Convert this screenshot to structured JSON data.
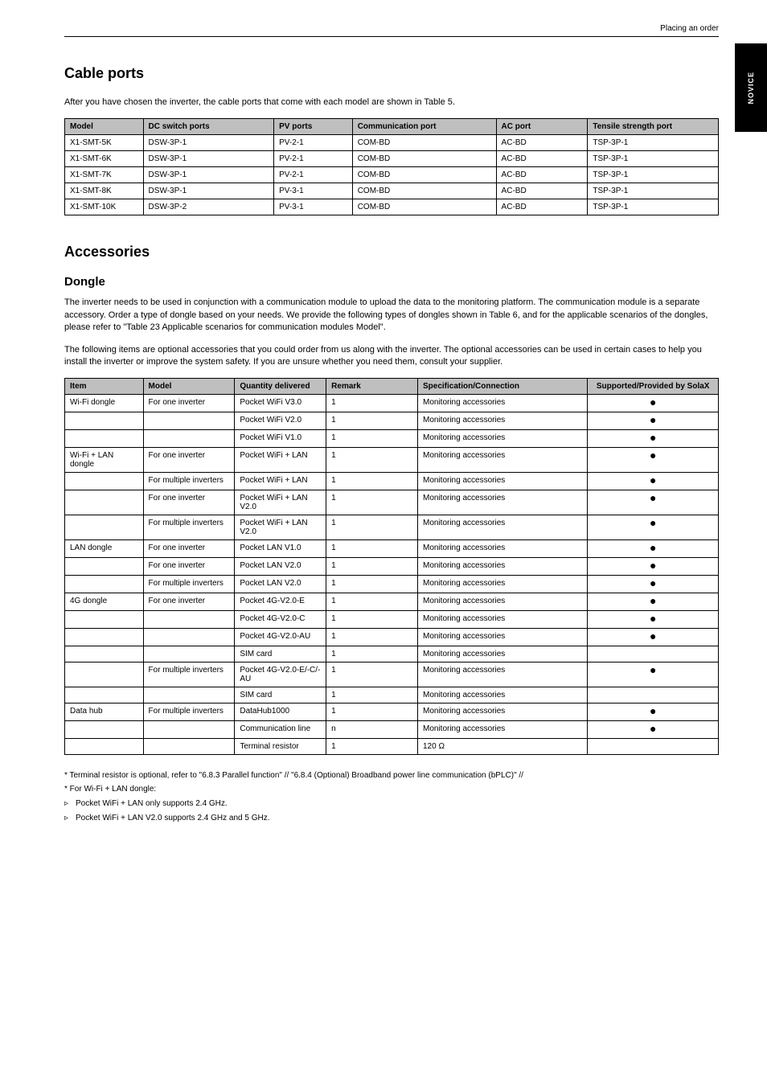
{
  "header": {
    "right": "Placing an order"
  },
  "tab": {
    "label": "NOVICE"
  },
  "section1": {
    "title": "Cable ports",
    "intro": "After you have chosen the inverter, the cable ports that come with each model are shown in Table 5.",
    "table": {
      "headers": [
        "Model",
        "DC switch ports",
        "PV ports",
        "Communication port",
        "AC port",
        "Tensile strength port"
      ],
      "rows": [
        [
          "X1-SMT-5K",
          "DSW-3P-1",
          "PV-2-1",
          "COM-BD",
          "AC-BD",
          "TSP-3P-1"
        ],
        [
          "X1-SMT-6K",
          "DSW-3P-1",
          "PV-2-1",
          "COM-BD",
          "AC-BD",
          "TSP-3P-1"
        ],
        [
          "X1-SMT-7K",
          "DSW-3P-1",
          "PV-2-1",
          "COM-BD",
          "AC-BD",
          "TSP-3P-1"
        ],
        [
          "X1-SMT-8K",
          "DSW-3P-1",
          "PV-3-1",
          "COM-BD",
          "AC-BD",
          "TSP-3P-1"
        ],
        [
          "X1-SMT-10K",
          "DSW-3P-2",
          "PV-3-1",
          "COM-BD",
          "AC-BD",
          "TSP-3P-1"
        ]
      ]
    }
  },
  "section2": {
    "title": "Accessories",
    "sub": "Dongle",
    "intro1": "The inverter needs to be used in conjunction with a communication module to upload the data to the monitoring platform. The communication module is a separate accessory. Order a type of dongle based on your needs. We provide the following types of dongles shown in Table 6, and for the applicable scenarios of the dongles, please refer to \"Table 23 Applicable scenarios for communication modules Model\".",
    "intro2": "The following items are optional accessories that you could order from us along with the inverter. The optional accessories can be used in certain cases to help you install the inverter or improve the system safety. If you are unsure whether you need them, consult your supplier.",
    "table": {
      "headers": [
        "Item",
        "Model",
        "Quantity delivered",
        "Remark",
        "Specification/Connection",
        "Supported/Provided by SolaX"
      ],
      "rows": [
        [
          "Wi-Fi dongle",
          "For one inverter",
          "Pocket WiFi V3.0",
          "1",
          "Monitoring accessories",
          "dot"
        ],
        [
          "",
          "",
          "Pocket WiFi V2.0",
          "1",
          "Monitoring accessories",
          "dot"
        ],
        [
          "",
          "",
          "Pocket WiFi V1.0",
          "1",
          "Monitoring accessories",
          "dot"
        ],
        [
          "Wi-Fi + LAN dongle",
          "For one inverter",
          "Pocket WiFi + LAN",
          "1",
          "Monitoring accessories",
          "dot"
        ],
        [
          "",
          "For multiple inverters",
          "Pocket WiFi + LAN",
          "1",
          "Monitoring accessories",
          "dot"
        ],
        [
          "",
          "For one inverter",
          "Pocket WiFi + LAN V2.0",
          "1",
          "Monitoring accessories",
          "dot"
        ],
        [
          "",
          "For multiple inverters",
          "Pocket WiFi + LAN V2.0",
          "1",
          "Monitoring accessories",
          "dot"
        ],
        [
          "LAN dongle",
          "For one inverter",
          "Pocket LAN V1.0",
          "1",
          "Monitoring accessories",
          "dot"
        ],
        [
          "",
          "For one inverter",
          "Pocket LAN V2.0",
          "1",
          "Monitoring accessories",
          "dot"
        ],
        [
          "",
          "For multiple inverters",
          "Pocket LAN V2.0",
          "1",
          "Monitoring accessories",
          "dot"
        ],
        [
          "4G dongle",
          "For one inverter",
          "Pocket 4G-V2.0-E",
          "1",
          "Monitoring accessories",
          "dot"
        ],
        [
          "",
          "",
          "Pocket 4G-V2.0-C",
          "1",
          "Monitoring accessories",
          "dot"
        ],
        [
          "",
          "",
          "Pocket 4G-V2.0-AU",
          "1",
          "Monitoring accessories",
          "dot"
        ],
        [
          "",
          "",
          "SIM card",
          "1",
          "Monitoring accessories",
          ""
        ],
        [
          "",
          "For multiple inverters",
          "Pocket 4G-V2.0-E/-C/-AU",
          "1",
          "Monitoring accessories",
          "dot"
        ],
        [
          "",
          "",
          "SIM card",
          "1",
          "Monitoring accessories",
          ""
        ],
        [
          "Data hub",
          "For multiple inverters",
          "DataHub1000",
          "1",
          "Monitoring accessories",
          "dot"
        ],
        [
          "",
          "",
          "Communication line",
          "n",
          "Monitoring accessories",
          "dot"
        ],
        [
          "",
          "",
          "Terminal resistor",
          "1",
          "120 Ω",
          ""
        ]
      ]
    }
  },
  "notes": {
    "line1": "* Terminal resistor is optional, refer to \"6.8.3 Parallel function\" // \"6.8.4 (Optional) Broadband power line communication (bPLC)\" //",
    "line2": "* For Wi-Fi + LAN dongle:",
    "bullets": [
      "Pocket WiFi + LAN only supports 2.4 GHz.",
      "Pocket WiFi + LAN V2.0 supports 2.4 GHz and 5 GHz."
    ]
  }
}
